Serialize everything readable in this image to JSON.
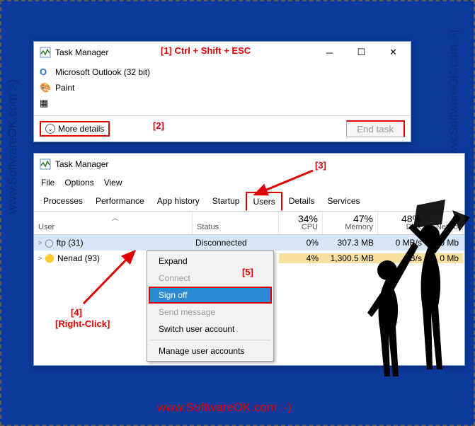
{
  "watermarks": {
    "vertical": "www.SoftwareOK.com :-)",
    "bottom": "www.SoftwareOK.com :-)"
  },
  "annotations": {
    "a1": "[1] Ctrl + Shift + ESC",
    "a2": "[2]",
    "a3": "[3]",
    "a4a": "[4]",
    "a4b": "[Right-Click]",
    "a5": "[5]"
  },
  "window_top": {
    "title": "Task Manager",
    "processes": [
      {
        "icon": "outlook",
        "name": "Microsoft Outlook (32 bit)"
      },
      {
        "icon": "paint",
        "name": "Paint"
      }
    ],
    "more_details": "More details",
    "end_task": "End task"
  },
  "window_bottom": {
    "title": "Task Manager",
    "menu": {
      "file": "File",
      "options": "Options",
      "view": "View"
    },
    "tabs": {
      "processes": "Processes",
      "performance": "Performance",
      "app_history": "App history",
      "startup": "Startup",
      "users": "Users",
      "details": "Details",
      "services": "Services"
    },
    "columns": {
      "user": "User",
      "status": "Status",
      "cpu_big": "34%",
      "cpu": "CPU",
      "mem_big": "47%",
      "mem": "Memory",
      "disk_big": "48%",
      "disk": "Disk",
      "net_big": "0",
      "net": "Netwo"
    },
    "rows": [
      {
        "expander": ">",
        "icon": "user",
        "name": "ftp (31)",
        "status": "Disconnected",
        "cpu": "0%",
        "mem": "307.3 MB",
        "disk": "0 MB/s",
        "net": "0 Mb"
      },
      {
        "expander": ">",
        "icon": "user-y",
        "name": "Nenad (93)",
        "status": "",
        "cpu": "4%",
        "mem": "1,300.5 MB",
        "disk": "B/s",
        "net": "0 Mb"
      }
    ]
  },
  "context_menu": {
    "expand": "Expand",
    "connect": "Connect",
    "sign_off": "Sign off",
    "send_message": "Send message",
    "switch_user": "Switch user account",
    "manage": "Manage user accounts"
  }
}
